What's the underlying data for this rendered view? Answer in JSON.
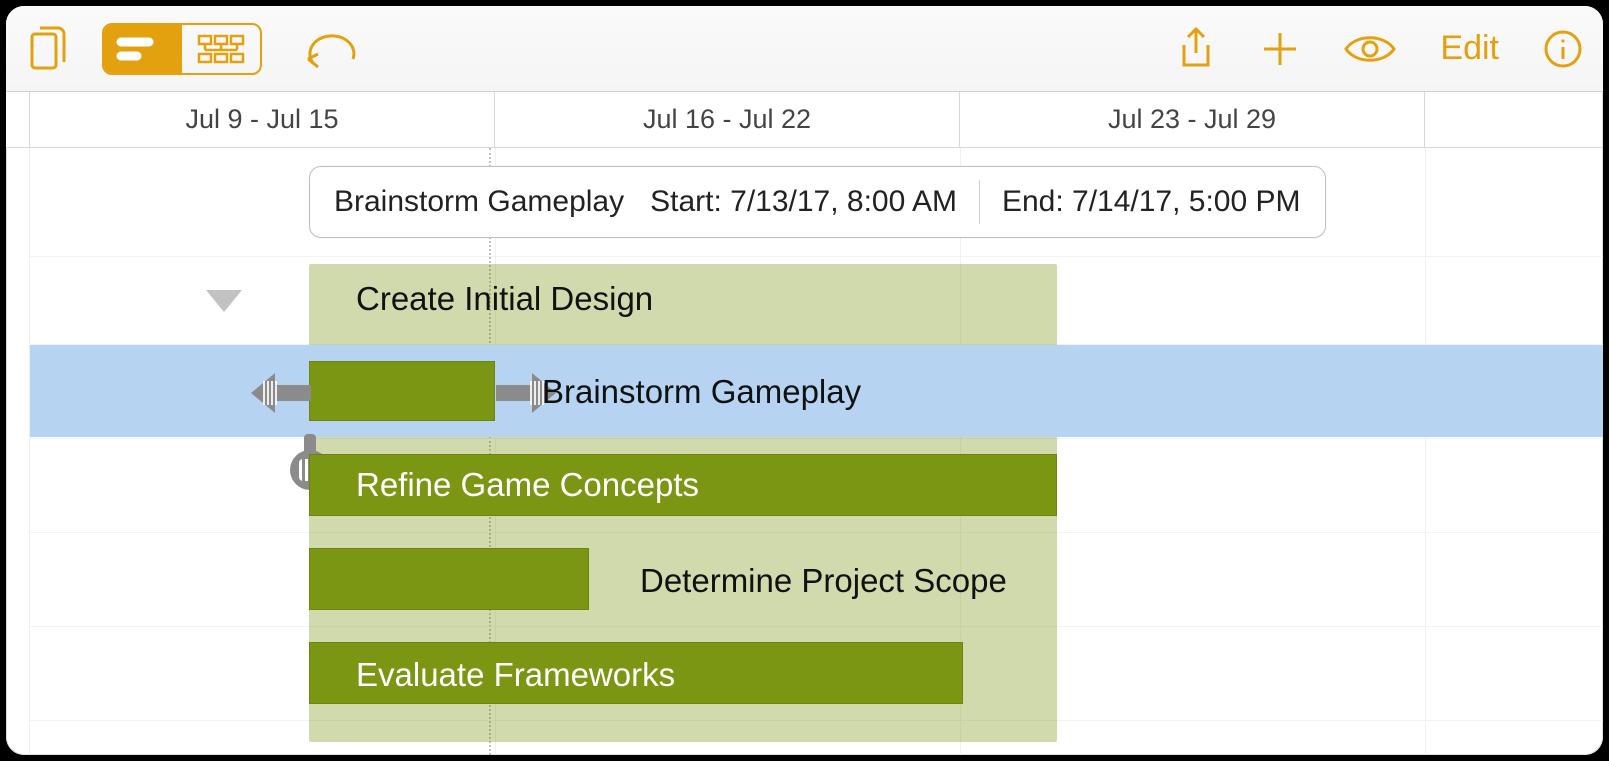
{
  "accent": "#E3A10F",
  "toolbar": {
    "edit_label": "Edit"
  },
  "date_header": {
    "weeks": [
      "Jul 9 - Jul 15",
      "Jul 16 - Jul 22",
      "Jul 23 - Jul 29"
    ]
  },
  "tooltip": {
    "task_name": "Brainstorm Gameplay",
    "start_label": "Start: 7/13/17, 8:00 AM",
    "end_label": "End: 7/14/17, 5:00 PM"
  },
  "group": {
    "name": "Create Initial Design"
  },
  "tasks": {
    "brainstorm": {
      "label": "Brainstorm Gameplay"
    },
    "refine": {
      "label": "Refine Game Concepts"
    },
    "scope": {
      "label": "Determine Project Scope"
    },
    "frameworks": {
      "label": "Evaluate Frameworks"
    }
  }
}
